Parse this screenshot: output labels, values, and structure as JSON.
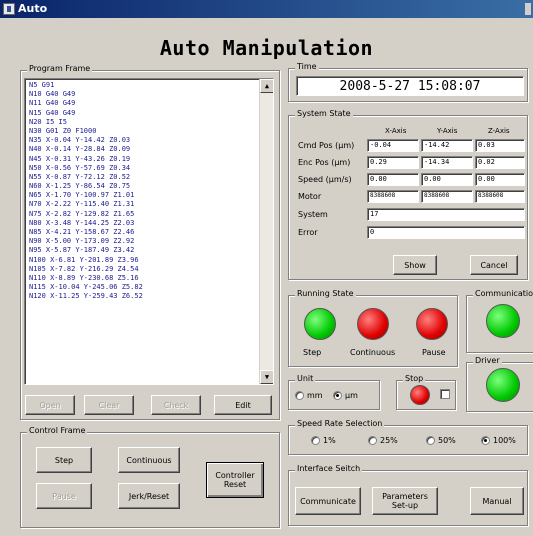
{
  "window": {
    "title": "Auto"
  },
  "heading": "Auto Manipulation",
  "program_frame": {
    "label": "Program Frame",
    "lines": [
      "N5 G91",
      "N10 G40 G49",
      "N11 G40 G49",
      "N15 G40 G49",
      "N20 I5 I5",
      "N30 G01 Z0 F1000",
      "N35 X-0.04 Y-14.42 Z0.03",
      "N40 X-0.14 Y-28.84 Z0.09",
      "N45 X-0.31 Y-43.26 Z0.19",
      "N50 X-0.56 Y-57.69 Z0.34",
      "N55 X-0.87 Y-72.12 Z0.52",
      "N60 X-1.25 Y-86.54 Z0.75",
      "N65 X-1.70 Y-100.97 Z1.01",
      "N70 X-2.22 Y-115.40 Z1.31",
      "N75 X-2.82 Y-129.82 Z1.65",
      "N80 X-3.48 Y-144.25 Z2.03",
      "N85 X-4.21 Y-158.67 Z2.46",
      "N90 X-5.00 Y-173.09 Z2.92",
      "N95 X-5.87 Y-187.49 Z3.42",
      "N100 X-6.81 Y-201.89 Z3.96",
      "N105 X-7.82 Y-216.29 Z4.54",
      "N110 X-8.89 Y-230.68 Z5.16",
      "N115 X-10.04 Y-245.06 Z5.82",
      "N120 X-11.25 Y-259.43 Z6.52"
    ],
    "buttons": {
      "open": "Open",
      "clear": "Clear",
      "check": "Check",
      "edit": "Edit"
    }
  },
  "control_frame": {
    "label": "Control Frame",
    "step": "Step",
    "continuous": "Continuous",
    "pause": "Pause",
    "jerk_reset": "Jerk/Reset",
    "controller_reset": "Controller\nReset"
  },
  "time": {
    "label": "Time",
    "value": "2008-5-27 15:08:07"
  },
  "system_state": {
    "label": "System State",
    "columns": [
      "X-Axis",
      "Y-Axis",
      "Z-Axis"
    ],
    "rows": [
      {
        "label": "Cmd Pos (μm)",
        "values": [
          "-0.04",
          "-14.42",
          "0.03"
        ]
      },
      {
        "label": "Enc Pos (μm)",
        "values": [
          "0.29",
          "-14.34",
          "0.02"
        ]
      },
      {
        "label": "Speed (μm/s)",
        "values": [
          "0.00",
          "0.00",
          "0.00"
        ]
      },
      {
        "label": "Motor",
        "values": [
          "8388608",
          "8388608",
          "8388608"
        ]
      }
    ],
    "system_label": "System",
    "system_value": "17",
    "error_label": "Error",
    "error_value": "0",
    "show": "Show",
    "cancel": "Cancel"
  },
  "running_state": {
    "label": "Running State",
    "step": "Step",
    "continuous": "Continuous",
    "pause": "Pause",
    "colors": {
      "step": "green",
      "continuous": "red",
      "pause": "red"
    }
  },
  "communication": {
    "label": "Communication"
  },
  "driver": {
    "label": "Driver"
  },
  "unit": {
    "label": "Unit",
    "mm": "mm",
    "um": "μm",
    "selected": "μm"
  },
  "stop": {
    "label": "Stop"
  },
  "speed_rate": {
    "label": "Speed Rate Selection",
    "options": [
      "1%",
      "25%",
      "50%",
      "100%"
    ],
    "selected": "100%"
  },
  "interface_switch": {
    "label": "Interface Seitch",
    "communicate": "Communicate",
    "parameters": "Parameters\nSet-up",
    "manual": "Manual"
  }
}
